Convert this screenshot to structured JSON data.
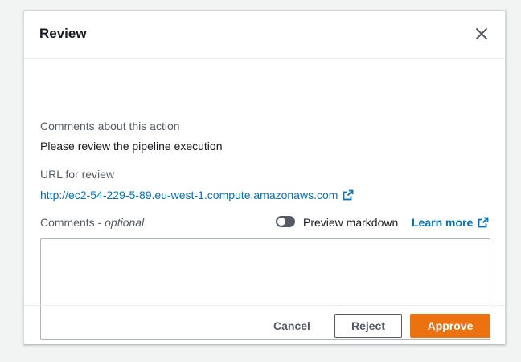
{
  "modal": {
    "title": "Review"
  },
  "fields": {
    "comments_about_label": "Comments about this action",
    "comments_about_value": "Please review the pipeline execution",
    "url_label": "URL for review",
    "url_value": "http://ec2-54-229-5-89.eu-west-1.compute.amazonaws.com",
    "comments_label": "Comments - ",
    "comments_optional": "optional",
    "comments_value": "",
    "preview_markdown_label": "Preview markdown",
    "preview_markdown_enabled": false,
    "learn_more_label": "Learn more"
  },
  "footer": {
    "cancel_label": "Cancel",
    "reject_label": "Reject",
    "approve_label": "Approve"
  },
  "colors": {
    "link": "#0073bb",
    "primary": "#ec7211",
    "toggle_off": "#545b64"
  },
  "icons": {
    "close": "close-icon",
    "external_link": "external-link-icon",
    "resize": "resize-grip-icon"
  }
}
